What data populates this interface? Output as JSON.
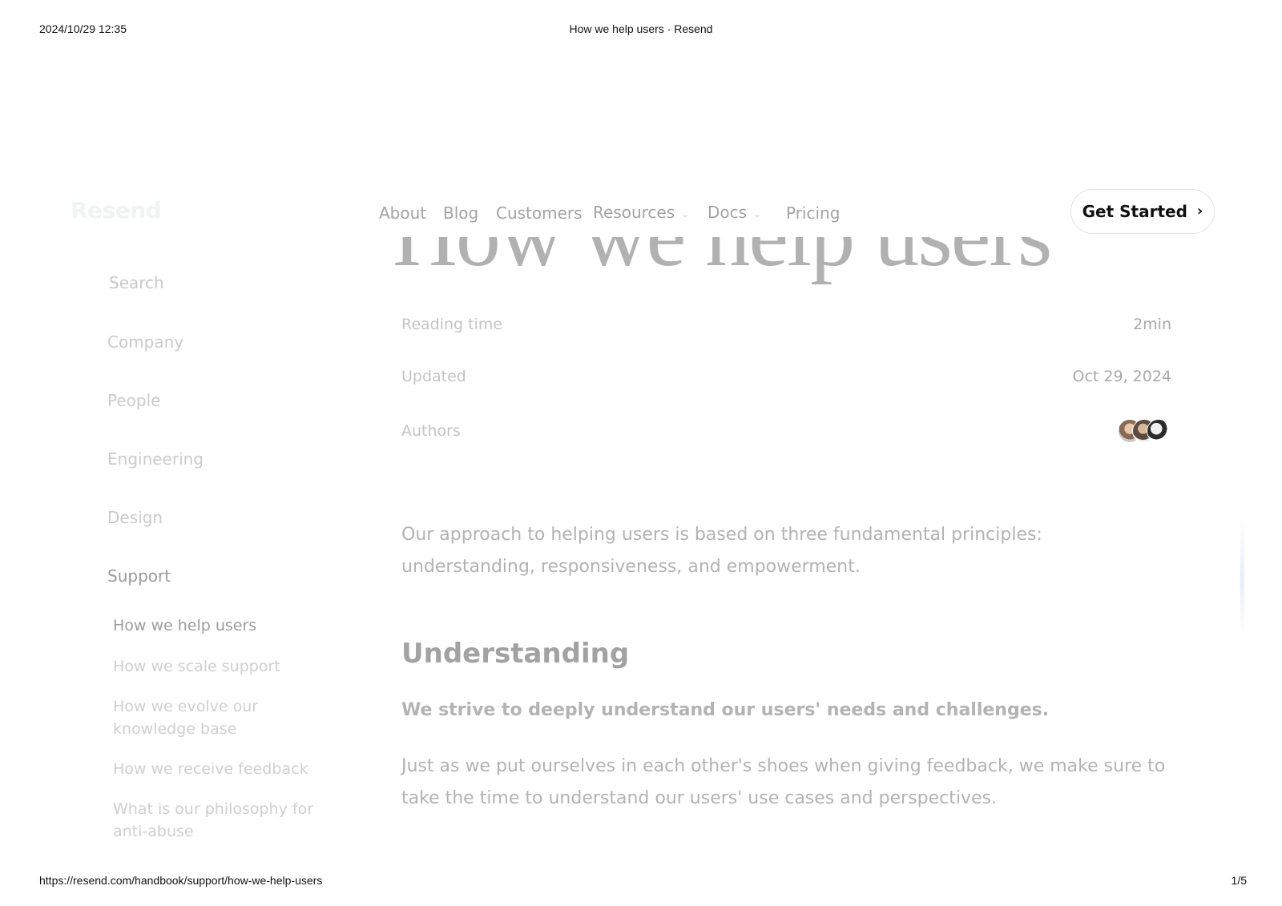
{
  "print": {
    "date": "2024/10/29 12:35",
    "title": "How we help users · Resend",
    "url": "https://resend.com/handbook/support/how-we-help-users",
    "page": "1/5"
  },
  "header": {
    "logo": "Resend",
    "nav": [
      "About",
      "Blog",
      "Customers",
      "Resources",
      "Docs",
      "Pricing"
    ],
    "cta_label": "Get Started"
  },
  "article": {
    "title": "How we help users",
    "meta": {
      "reading_time_label": "Reading time",
      "reading_time_value": "2min",
      "updated_label": "Updated",
      "updated_value": "Oct 29, 2024",
      "authors_label": "Authors"
    },
    "intro": "Our approach to helping users is based on three fundamental principles: understanding, responsiveness, and empowerment.",
    "section_heading": "Understanding",
    "section_lead": "We strive to deeply understand our users' needs and challenges.",
    "section_body": "Just as we put ourselves in each other's shoes when giving feedback, we make sure to take the time to understand our users' use cases and perspectives."
  },
  "sidebar": {
    "search_placeholder": "Search",
    "sections": [
      "Company",
      "People",
      "Engineering",
      "Design",
      "Support"
    ],
    "support_items": [
      "How we help users",
      "How we scale support",
      "How we evolve our knowledge base",
      "How we receive feedback",
      "What is our philosophy for anti-abuse"
    ]
  },
  "colors": {
    "text_muted": "#b3b3b3",
    "cta_border": "#e2e2e2"
  }
}
